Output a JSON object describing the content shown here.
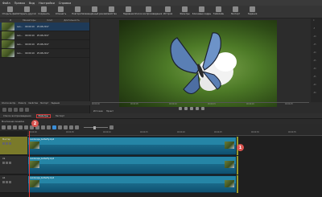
{
  "menu": [
    "Файл",
    "Правка",
    "Вид",
    "Настройки",
    "Справка"
  ],
  "toolbar": [
    {
      "label": "Открыть файл",
      "icon": "folder-open-icon"
    },
    {
      "label": "Открыть другой",
      "icon": "folder-icon"
    },
    {
      "label": "Сохранить",
      "icon": "save-icon"
    },
    {
      "label": "Отменить",
      "icon": "undo-icon"
    },
    {
      "label": "Повторить",
      "icon": "redo-icon"
    },
    {
      "label": "Совмещённый режим",
      "icon": "layout-icon"
    },
    {
      "label": "Свойства",
      "icon": "properties-icon"
    },
    {
      "label": "Недавние",
      "icon": "recent-icon"
    },
    {
      "label": "Список воспроизведения",
      "icon": "playlist-icon"
    },
    {
      "label": "История",
      "icon": "history-icon"
    },
    {
      "label": "Фильтры",
      "icon": "filters-icon"
    },
    {
      "label": "Ключевые кадры",
      "icon": "keyframes-icon"
    },
    {
      "label": "Таймлайн",
      "icon": "timeline-icon"
    },
    {
      "label": "Экспорт",
      "icon": "export-icon"
    },
    {
      "label": "Задания",
      "icon": "jobs-icon"
    }
  ],
  "playlist": {
    "columns": [
      "#",
      "Миниатюры",
      "Клип",
      "Длительность",
      "Дата"
    ],
    "rows": [
      {
        "name": "Lan...",
        "dur": "00:00:10",
        "date": "25.08.2017"
      },
      {
        "name": "Lan...",
        "dur": "00:00:10",
        "date": "25.08.2017"
      },
      {
        "name": "Lan...",
        "dur": "00:00:10",
        "date": "25.08.2017"
      },
      {
        "name": "Lan...",
        "dur": "00:00:10",
        "date": "25.08.2017"
      }
    ],
    "tabs": [
      "Список воспр.",
      "Фильтр",
      "Свойства",
      "Экспорт",
      "Задания"
    ]
  },
  "player": {
    "ticks": [
      "00:00:00",
      "00:00:05",
      "00:00:10",
      "00:00:15",
      "00:00:20",
      "00:00:25"
    ],
    "tabs": [
      "Источник",
      "Проект"
    ],
    "scale": [
      "0",
      "-5",
      "-10",
      "-15",
      "-20",
      "-25",
      "-30",
      "-35",
      "-40",
      "-50"
    ]
  },
  "panel_tabs": [
    "Список воспроизведения",
    "Фильтры",
    "Экспорт"
  ],
  "timeline": {
    "label": "Монтажная линейка",
    "ruler": [
      "00:00:00",
      "00:00:05",
      "00:00:10",
      "00:00:15",
      "00:00:20",
      "00:00:25",
      "00:00:30",
      "00:00:35"
    ],
    "tracks": [
      {
        "name": "Мастер",
        "clip": "Landscape_butterfly.mp4"
      },
      {
        "name": "V1",
        "clip": "Landscape_butterfly.mp4"
      },
      {
        "name": "A1",
        "clip": "Landscape_butterfly.mp4"
      }
    ]
  },
  "markers": [
    "1",
    "2"
  ]
}
